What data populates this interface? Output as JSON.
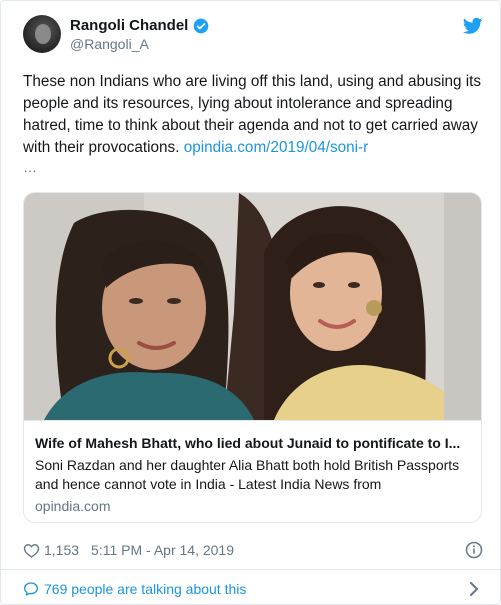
{
  "author": {
    "display_name": "Rangoli Chandel",
    "handle": "@Rangoli_A",
    "avatar_icon": "user-avatar",
    "verified_icon": "verified-badge-icon",
    "brand_icon": "twitter-bird-icon"
  },
  "tweet": {
    "text": "These non Indians who are living off this land, using and abusing its people and its resources, lying about intolerance and spreading hatred, time to think about their agenda and not to get carried away with their provocations.",
    "link_text": "opindia.com/2019/04/soni-r",
    "ellipsis": "…"
  },
  "link_card": {
    "title": "Wife of Mahesh Bhatt, who lied about Junaid to pontificate to I...",
    "description": "Soni Razdan and her daughter Alia Bhatt both hold British Passports and hence cannot vote in India - Latest India News from",
    "domain": "opindia.com"
  },
  "meta": {
    "like_count": "1,153",
    "timestamp": "5:11 PM - Apr 14, 2019"
  },
  "footer": {
    "talking_text": "769 people are talking about this"
  },
  "colors": {
    "link_blue": "#1b95e0",
    "text_primary": "#14171a",
    "text_secondary": "#657786",
    "border": "#e1e8ed"
  }
}
